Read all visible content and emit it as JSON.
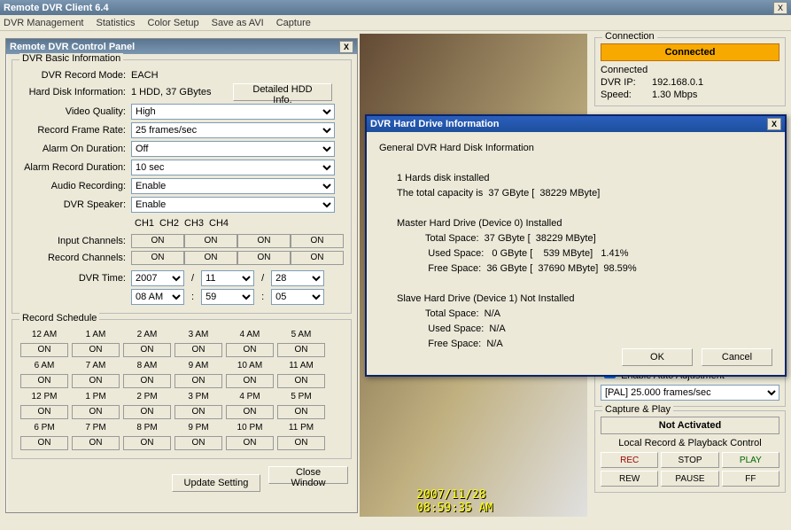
{
  "app": {
    "title": "Remote DVR Client 6.4"
  },
  "menu": [
    "DVR Management",
    "Statistics",
    "Color Setup",
    "Save as AVI",
    "Capture"
  ],
  "cp": {
    "title": "Remote DVR Control Panel",
    "basic_legend": "DVR Basic Information",
    "record_mode_lab": "DVR Record Mode:",
    "record_mode_val": "EACH",
    "hdd_lab": "Hard Disk Information:",
    "hdd_val": "1 HDD, 37 GBytes",
    "hdd_btn": "Detailed HDD Info.",
    "vq_lab": "Video Quality:",
    "vq_val": "High",
    "rfr_lab": "Record Frame Rate:",
    "rfr_val": "25 frames/sec",
    "aod_lab": "Alarm On Duration:",
    "aod_val": "Off",
    "ard_lab": "Alarm Record Duration:",
    "ard_val": "10 sec",
    "aud_lab": "Audio Recording:",
    "aud_val": "Enable",
    "spk_lab": "DVR Speaker:",
    "spk_val": "Enable",
    "chs": [
      "CH1",
      "CH2",
      "CH3",
      "CH4"
    ],
    "inp_lab": "Input Channels:",
    "rec_lab": "Record Channels:",
    "on": "ON",
    "dt_lab": "DVR Time:",
    "year": "2007",
    "month": "11",
    "day": "28",
    "ampm": "08 AM",
    "min": "59",
    "sec": "05",
    "slash": "/",
    "colon": ":",
    "sched_legend": "Record Schedule",
    "sched_times": [
      "12 AM",
      "1 AM",
      "2 AM",
      "3 AM",
      "4 AM",
      "5 AM",
      "6 AM",
      "7 AM",
      "8 AM",
      "9 AM",
      "10 AM",
      "11 AM",
      "12 PM",
      "1 PM",
      "2 PM",
      "3 PM",
      "4 PM",
      "5 PM",
      "6 PM",
      "7 PM",
      "8 PM",
      "9 PM",
      "10 PM",
      "11 PM"
    ],
    "update_btn": "Update Setting",
    "close_btn": "Close Window"
  },
  "camera": {
    "timestamp": "2007/11/28 08:59:35 AM"
  },
  "conn": {
    "legend": "Connection",
    "status_bar": "Connected",
    "status_text": "Connected",
    "ip_lab": "DVR IP:",
    "ip_val": "192.168.0.1",
    "speed_lab": "Speed:",
    "speed_val": "1.30 Mbps"
  },
  "video_adj": {
    "checkbox_label": "Enable Auto Adjustment",
    "val": "[PAL] 25.000 frames/sec"
  },
  "capture": {
    "legend": "Capture & Play",
    "status": "Not Activated",
    "sub": "Local Record & Playback Control",
    "btns": [
      "REC",
      "STOP",
      "PLAY",
      "REW",
      "PAUSE",
      "FF"
    ]
  },
  "dlg": {
    "title": "DVR Hard Drive Information",
    "header": "General DVR Hard Disk Information",
    "l1": "1 Hards disk installed",
    "l2": "The total capacity is  37 GByte [  38229 MByte]",
    "m_head": "Master Hard Drive (Device 0)   Installed",
    "m_total": "    Total Space:  37 GByte [  38229 MByte]",
    "m_used": "     Used Space:   0 GByte [    539 MByte]   1.41%",
    "m_free": "     Free Space:  36 GByte [  37690 MByte]  98.59%",
    "s_head": "Slave Hard Drive (Device 1)   Not Installed",
    "s_total": "    Total Space:  N/A",
    "s_used": "     Used Space:  N/A",
    "s_free": "     Free Space:  N/A",
    "ok": "OK",
    "cancel": "Cancel"
  }
}
